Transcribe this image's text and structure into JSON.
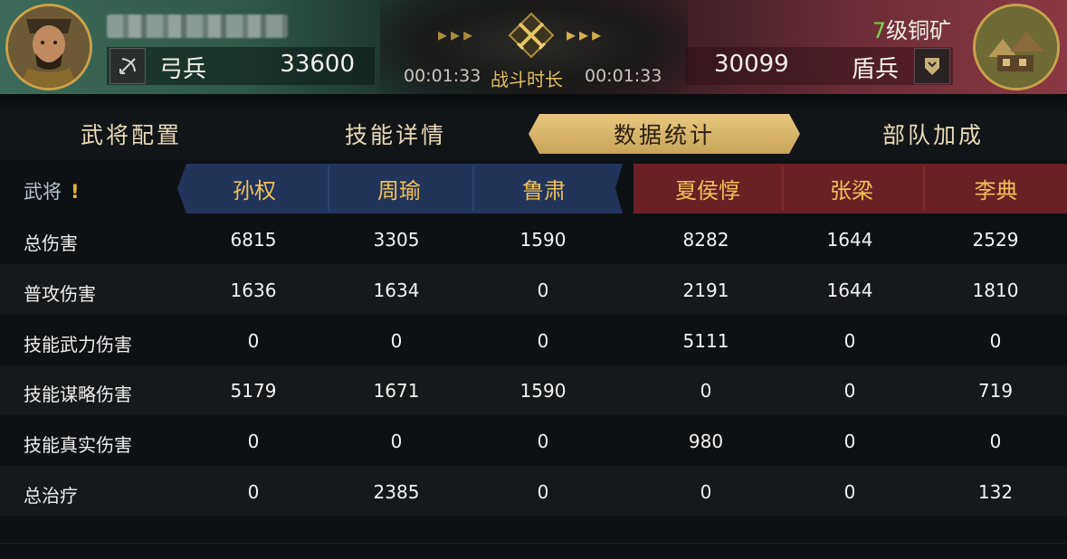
{
  "header": {
    "left": {
      "troop_type": "弓兵",
      "troop_count": "33600"
    },
    "center": {
      "time_left": "00:01:33",
      "label": "战斗时长",
      "time_right": "00:01:33"
    },
    "right": {
      "level": "7",
      "target_name": "级铜矿",
      "troop_type": "盾兵",
      "troop_count": "30099"
    }
  },
  "tabs": [
    {
      "label": "武将配置",
      "active": false
    },
    {
      "label": "技能详情",
      "active": false
    },
    {
      "label": "数据统计",
      "active": true
    },
    {
      "label": "部队加成",
      "active": false
    }
  ],
  "table": {
    "generals_label": "武将",
    "alert_mark": "!",
    "our_generals": [
      "孙权",
      "周瑜",
      "鲁肃"
    ],
    "enemy_generals": [
      "夏侯惇",
      "张梁",
      "李典"
    ],
    "rows": [
      {
        "label": "总伤害",
        "values": [
          "6815",
          "3305",
          "1590",
          "8282",
          "1644",
          "2529"
        ]
      },
      {
        "label": "普攻伤害",
        "values": [
          "1636",
          "1634",
          "0",
          "2191",
          "1644",
          "1810"
        ]
      },
      {
        "label": "技能武力伤害",
        "values": [
          "0",
          "0",
          "0",
          "5111",
          "0",
          "0"
        ]
      },
      {
        "label": "技能谋略伤害",
        "values": [
          "5179",
          "1671",
          "1590",
          "0",
          "0",
          "719"
        ]
      },
      {
        "label": "技能真实伤害",
        "values": [
          "0",
          "0",
          "0",
          "980",
          "0",
          "0"
        ]
      },
      {
        "label": "总治疗",
        "values": [
          "0",
          "2385",
          "0",
          "0",
          "0",
          "132"
        ]
      }
    ]
  },
  "colors": {
    "our_side": "#22345a",
    "enemy_side": "#6a2025",
    "gold_text": "#efc15a",
    "level_green": "#7fd24a"
  }
}
